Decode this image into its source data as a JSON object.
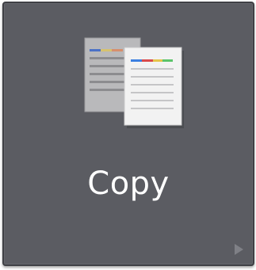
{
  "tile": {
    "label": "Copy",
    "icon": "copy-documents-icon",
    "arrow_icon": "expand-arrow-icon"
  },
  "colors": {
    "tile_background": "#5b5c62",
    "tile_border": "#3f4045",
    "label_color": "#ffffff",
    "arrow_color": "#7f8086",
    "document_back": "#b9b9bb",
    "document_front": "#f2f2f2"
  }
}
